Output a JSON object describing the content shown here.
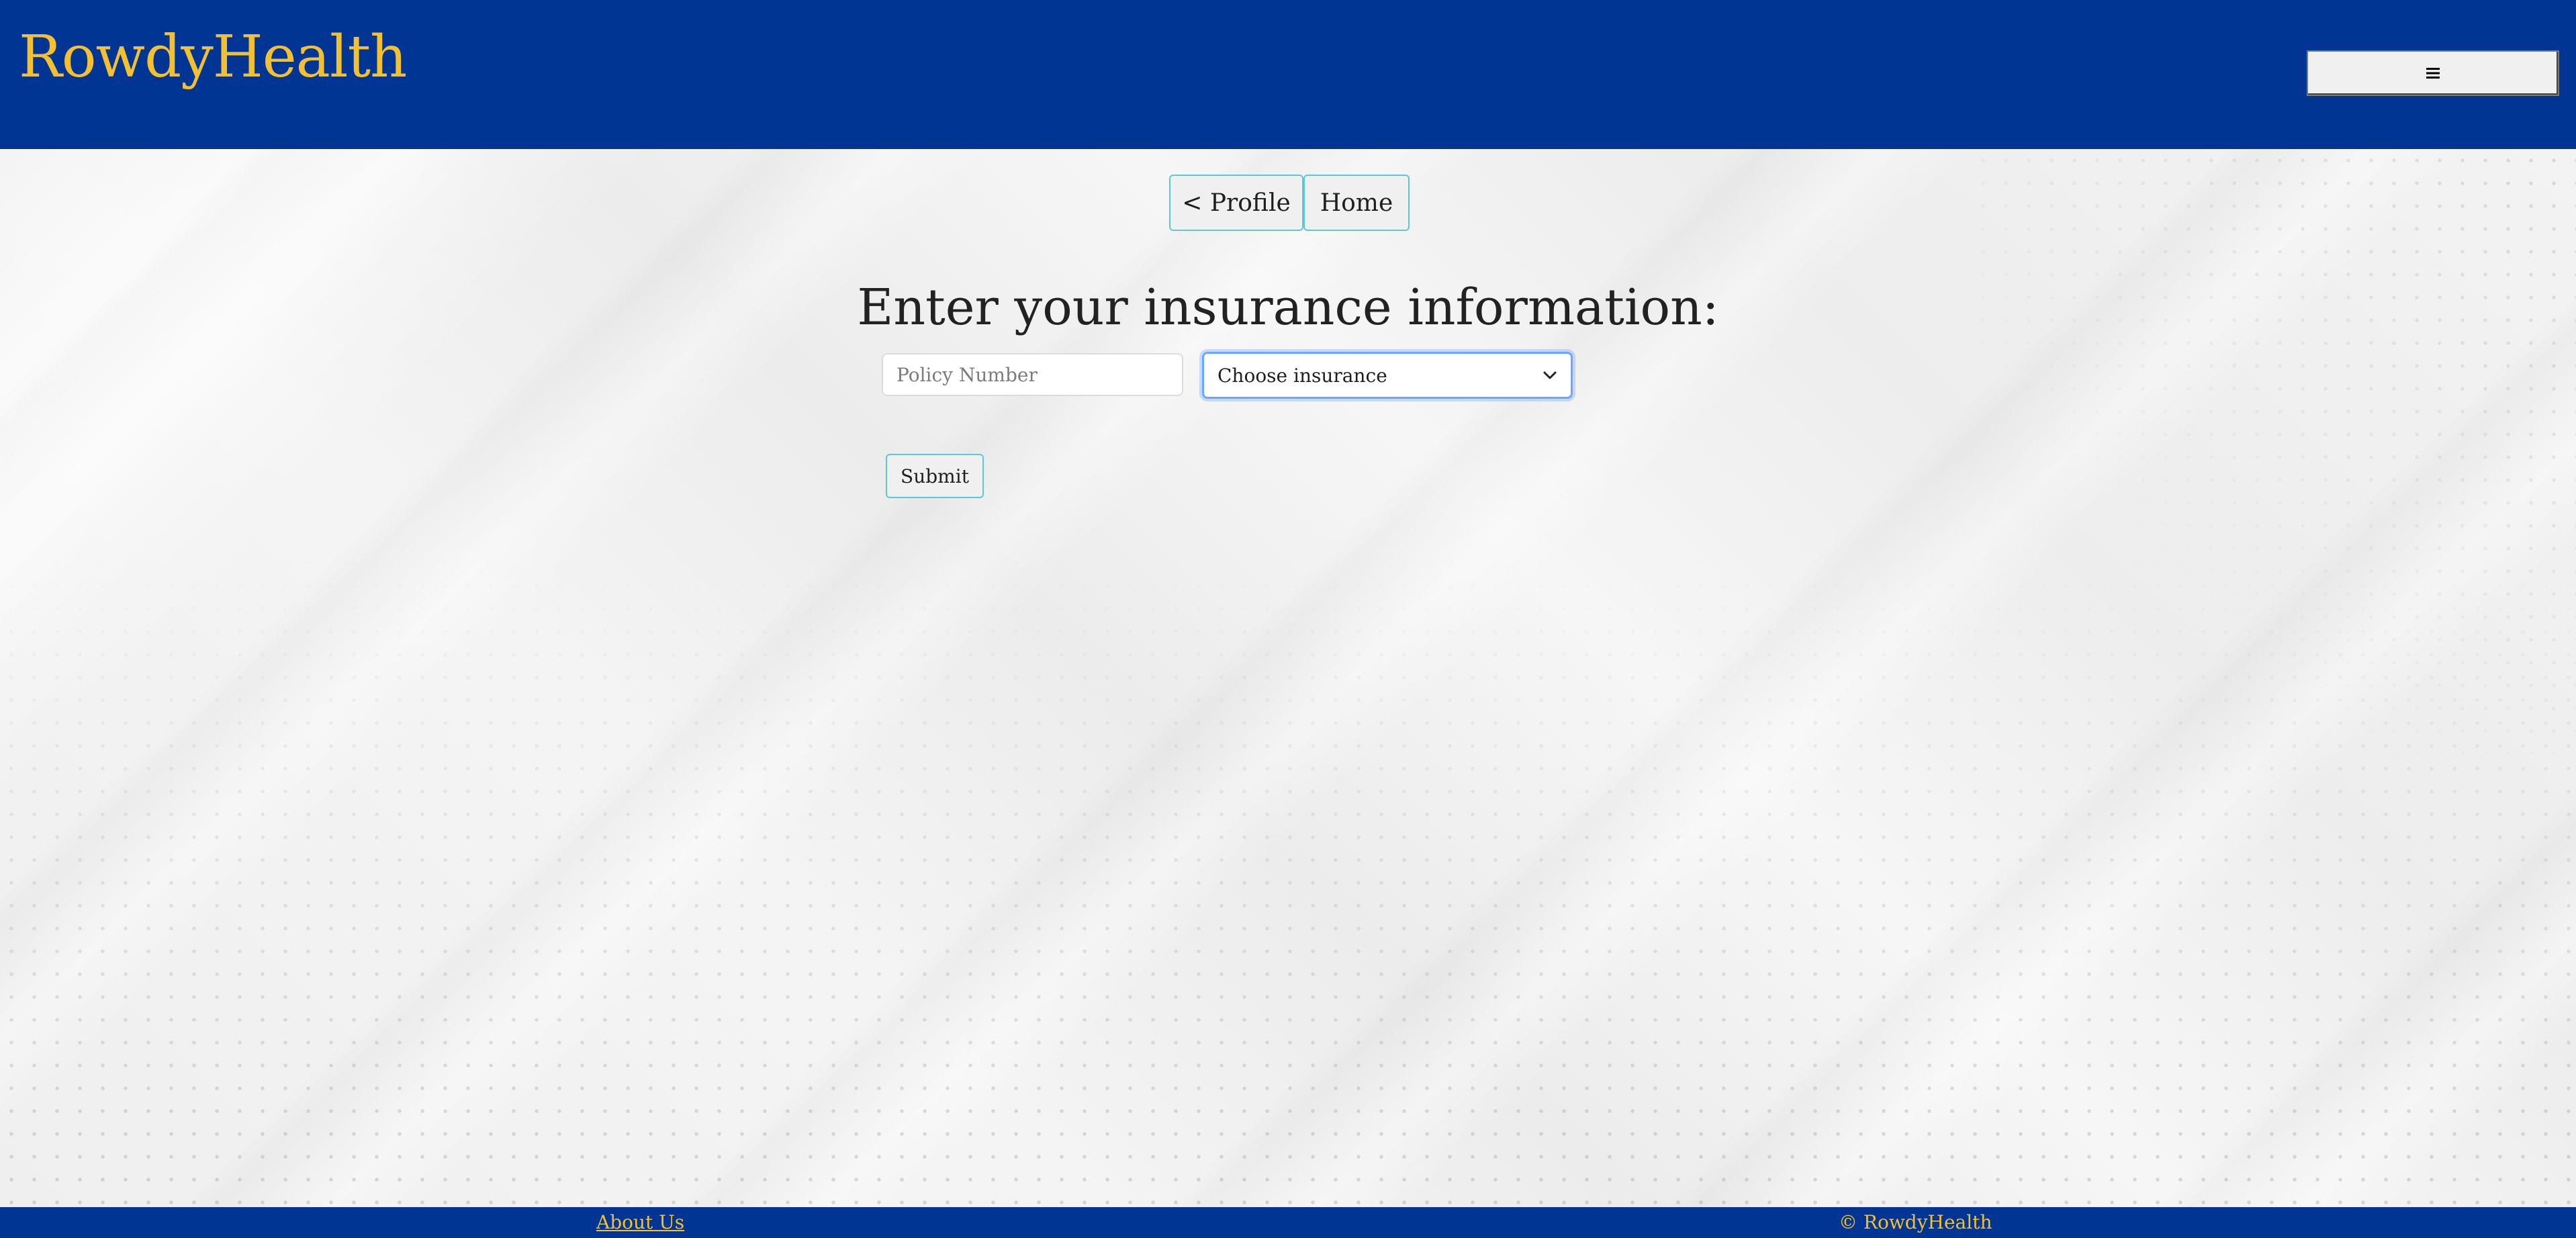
{
  "header": {
    "brand": "RowdyHealth",
    "menu_icon": "hamburger-icon"
  },
  "nav": {
    "profile_label": "< Profile",
    "home_label": "Home"
  },
  "form": {
    "title": "Enter your insurance information:",
    "policy_placeholder": "Policy Number",
    "policy_value": "",
    "insurance_selected": "Choose insurance",
    "submit_label": "Submit"
  },
  "footer": {
    "about_label": "About Us",
    "copyright": "© RowdyHealth"
  },
  "colors": {
    "brand_blue": "#003594",
    "brand_gold": "#f2c031",
    "button_border": "#5cc8d4",
    "focus_ring": "#6ea6ff"
  }
}
